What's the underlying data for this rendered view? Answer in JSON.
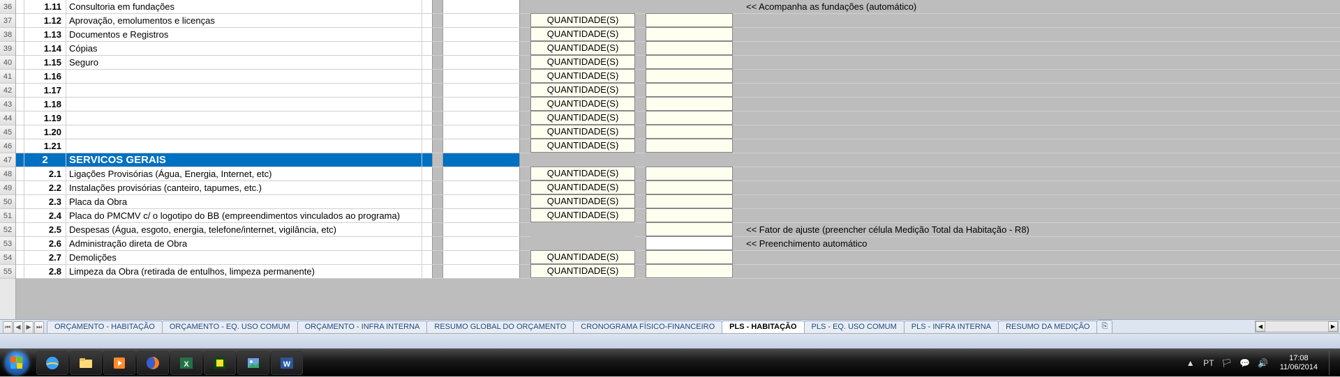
{
  "rowHeaders": [
    36,
    37,
    38,
    39,
    40,
    41,
    42,
    43,
    44,
    45,
    46,
    47,
    48,
    49,
    50,
    51,
    52,
    53,
    54,
    55
  ],
  "rows": [
    {
      "type": "item",
      "num": "1.11",
      "desc": "Consultoria em fundações",
      "q": "",
      "h": "none",
      "f": "none",
      "notePath": "notes.foundations"
    },
    {
      "type": "item",
      "num": "1.12",
      "desc": "Aprovação, emolumentos e licenças",
      "q": "QUANTIDADE(S)",
      "h": "y"
    },
    {
      "type": "item",
      "num": "1.13",
      "desc": "Documentos e Registros",
      "q": "QUANTIDADE(S)",
      "h": "y"
    },
    {
      "type": "item",
      "num": "1.14",
      "desc": "Cópias",
      "q": "QUANTIDADE(S)",
      "h": "y"
    },
    {
      "type": "item",
      "num": "1.15",
      "desc": "Seguro",
      "q": "QUANTIDADE(S)",
      "h": "y"
    },
    {
      "type": "item",
      "num": "1.16",
      "desc": "",
      "q": "QUANTIDADE(S)",
      "h": "y"
    },
    {
      "type": "item",
      "num": "1.17",
      "desc": "",
      "q": "QUANTIDADE(S)",
      "h": "y"
    },
    {
      "type": "item",
      "num": "1.18",
      "desc": "",
      "q": "QUANTIDADE(S)",
      "h": "y"
    },
    {
      "type": "item",
      "num": "1.19",
      "desc": "",
      "q": "QUANTIDADE(S)",
      "h": "y"
    },
    {
      "type": "item",
      "num": "1.20",
      "desc": "",
      "q": "QUANTIDADE(S)",
      "h": "y"
    },
    {
      "type": "item",
      "num": "1.21",
      "desc": "",
      "q": "QUANTIDADE(S)",
      "h": "y"
    },
    {
      "type": "section",
      "num": "2",
      "desc": "SERVICOS GERAIS"
    },
    {
      "type": "item",
      "num": "2.1",
      "desc": "Ligações Provisórias (Água, Energia, Internet, etc)",
      "q": "QUANTIDADE(S)",
      "h": "y"
    },
    {
      "type": "item",
      "num": "2.2",
      "desc": "Instalações provisórias (canteiro, tapumes, etc.)",
      "q": "QUANTIDADE(S)",
      "h": "y"
    },
    {
      "type": "item",
      "num": "2.3",
      "desc": "Placa da Obra",
      "q": "QUANTIDADE(S)",
      "h": "y"
    },
    {
      "type": "item",
      "num": "2.4",
      "desc": "Placa do PMCMV c/ o logotipo do BB (empreendimentos vinculados ao programa)",
      "q": "QUANTIDADE(S)",
      "h": "y"
    },
    {
      "type": "item",
      "num": "2.5",
      "desc": "Despesas (Água, esgoto, energia, telefone/internet,  vigilância, etc)",
      "q": "",
      "f": "none",
      "h": "y",
      "notePath": "notes.adjust"
    },
    {
      "type": "item",
      "num": "2.6",
      "desc": "Administração direta de Obra",
      "q": "",
      "f": "none",
      "h": "white",
      "notePath": "notes.auto"
    },
    {
      "type": "item",
      "num": "2.7",
      "desc": "Demolições",
      "q": "QUANTIDADE(S)",
      "h": "y"
    },
    {
      "type": "item",
      "num": "2.8",
      "desc": "Limpeza da Obra (retirada de entulhos, limpeza permanente)",
      "q": "QUANTIDADE(S)",
      "h": "y"
    }
  ],
  "notes": {
    "foundations": "<< Acompanha as fundações (automático)",
    "adjust": "<< Fator de ajuste (preencher célula Medição Total da Habitação - R8)",
    "auto": "<< Preenchimento automático"
  },
  "tabs": [
    {
      "label": "ORÇAMENTO - HABITAÇÃO",
      "active": false
    },
    {
      "label": "ORÇAMENTO - EQ. USO COMUM",
      "active": false
    },
    {
      "label": "ORÇAMENTO - INFRA INTERNA",
      "active": false
    },
    {
      "label": "RESUMO GLOBAL DO ORÇAMENTO",
      "active": false
    },
    {
      "label": "CRONOGRAMA FÍSICO-FINANCEIRO",
      "active": false
    },
    {
      "label": "PLS - HABITAÇÃO",
      "active": true,
      "strong": "HABITAÇÃO"
    },
    {
      "label": "PLS - EQ. USO COMUM",
      "active": false
    },
    {
      "label": "PLS - INFRA INTERNA",
      "active": false
    },
    {
      "label": "RESUMO DA MEDIÇÃO",
      "active": false
    }
  ],
  "navBtns": [
    "⏮",
    "◀",
    "▶",
    "⏭"
  ],
  "tray": {
    "lang": "PT",
    "time": "17:08",
    "date": "11/06/2014"
  }
}
